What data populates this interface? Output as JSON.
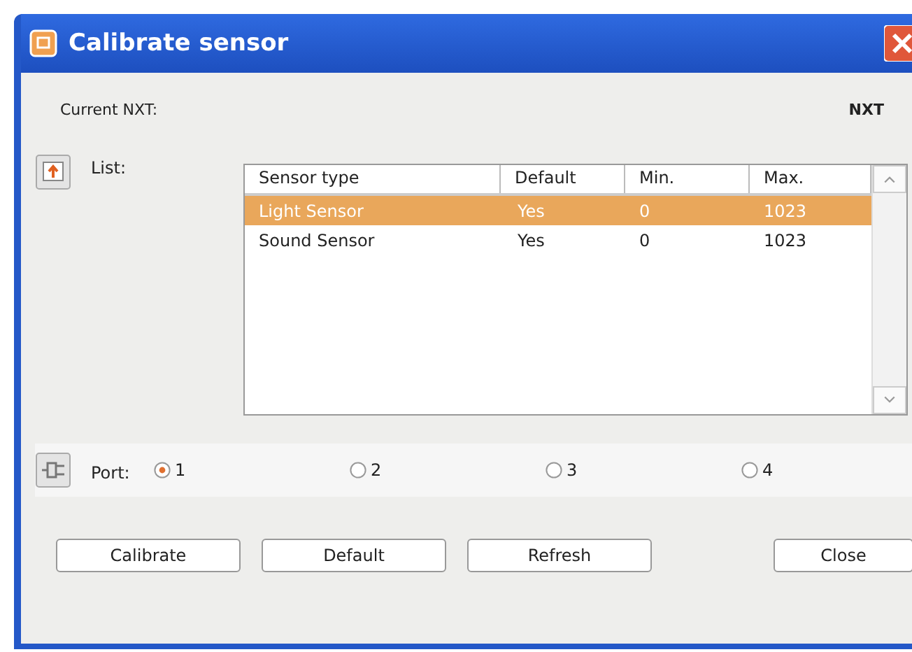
{
  "window": {
    "title": "Calibrate sensor"
  },
  "current_nxt": {
    "label": "Current NXT:",
    "value": "NXT"
  },
  "list": {
    "label": "List:",
    "columns": [
      "Sensor type",
      "Default",
      "Min.",
      "Max."
    ],
    "rows": [
      {
        "cells": [
          "Light Sensor",
          "Yes",
          "0",
          "1023"
        ],
        "selected": true
      },
      {
        "cells": [
          "Sound Sensor",
          "Yes",
          "0",
          "1023"
        ],
        "selected": false
      }
    ]
  },
  "port": {
    "label": "Port:",
    "options": [
      {
        "label": "1",
        "selected": true
      },
      {
        "label": "2",
        "selected": false
      },
      {
        "label": "3",
        "selected": false
      },
      {
        "label": "4",
        "selected": false
      }
    ]
  },
  "buttons": [
    "Calibrate",
    "Default",
    "Refresh",
    "Close"
  ]
}
